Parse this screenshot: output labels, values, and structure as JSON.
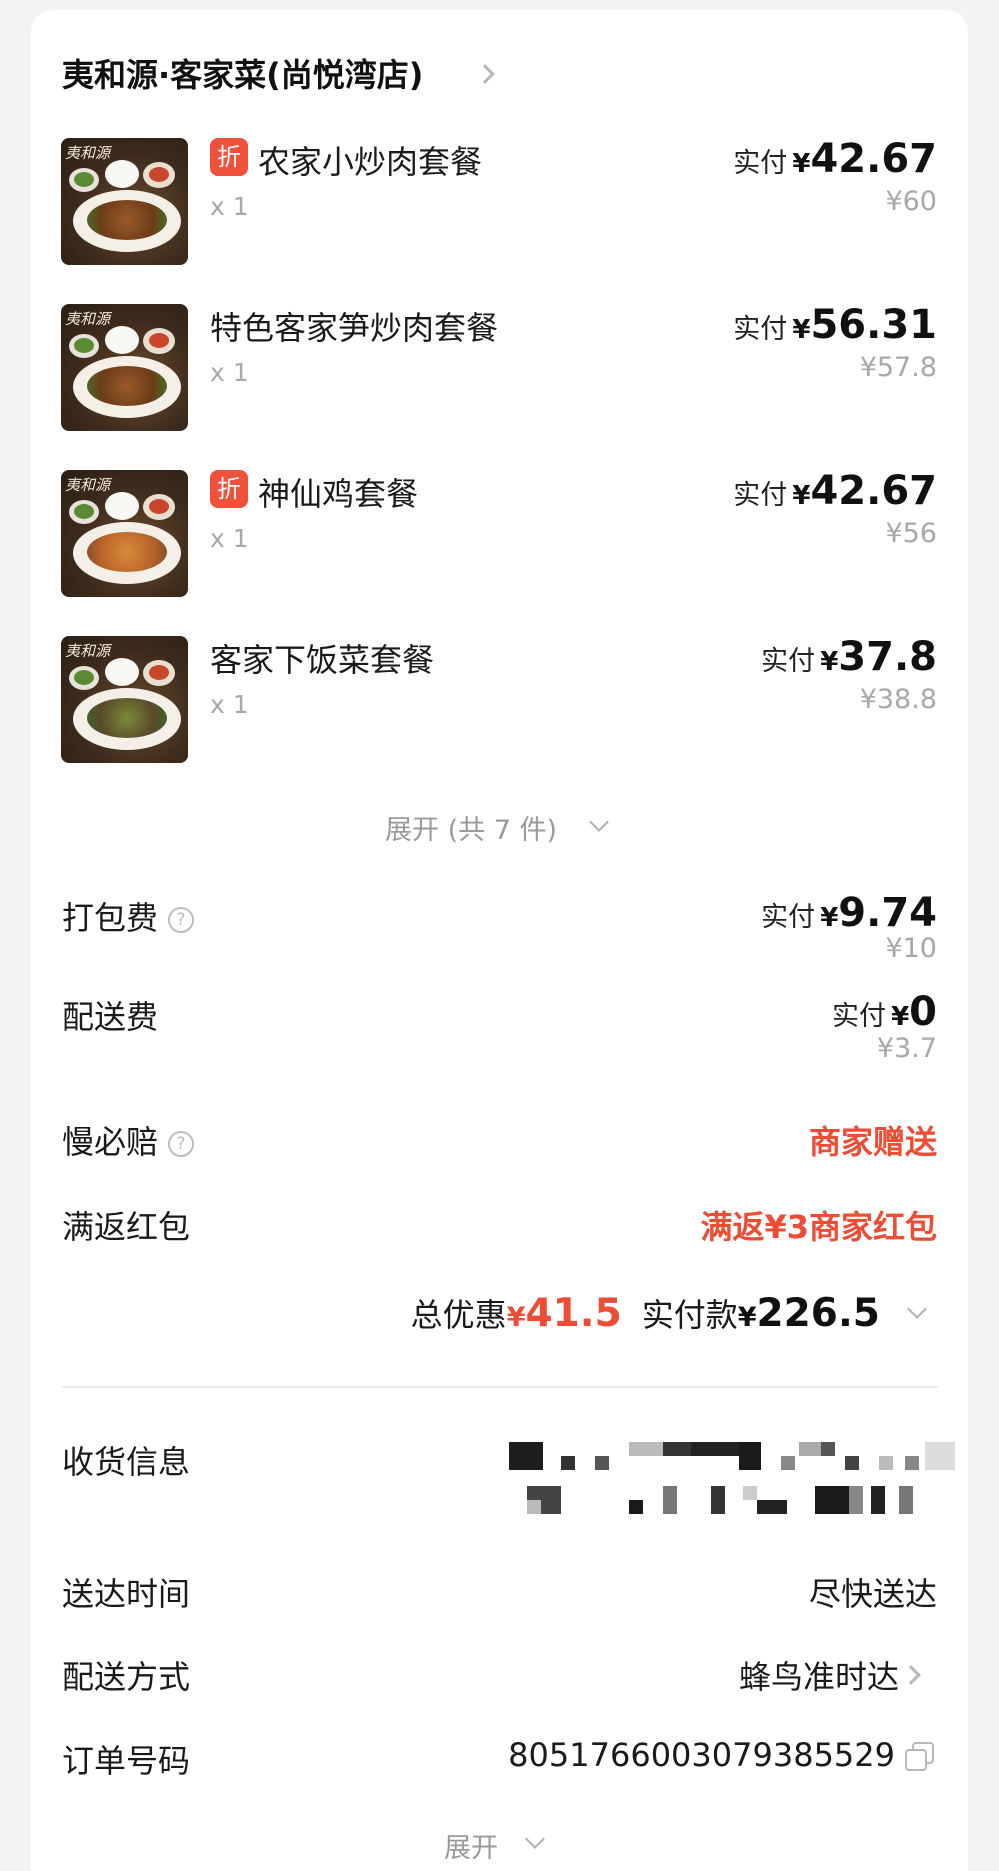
{
  "store": {
    "name": "夷和源·客家菜(尚悦湾店)"
  },
  "items": [
    {
      "name": "农家小炒肉套餐",
      "discount_tag": "折",
      "qty": "x 1",
      "paid_label": "实付",
      "currency": "¥",
      "paid": "42.67",
      "original": "¥60",
      "brand_text": "夷和源"
    },
    {
      "name": "特色客家笋炒肉套餐",
      "discount_tag": "",
      "qty": "x 1",
      "paid_label": "实付",
      "currency": "¥",
      "paid": "56.31",
      "original": "¥57.8",
      "brand_text": "夷和源"
    },
    {
      "name": "神仙鸡套餐",
      "discount_tag": "折",
      "qty": "x 1",
      "paid_label": "实付",
      "currency": "¥",
      "paid": "42.67",
      "original": "¥56",
      "brand_text": "夷和源"
    },
    {
      "name": "客家下饭菜套餐",
      "discount_tag": "",
      "qty": "x 1",
      "paid_label": "实付",
      "currency": "¥",
      "paid": "37.8",
      "original": "¥38.8",
      "brand_text": "夷和源"
    }
  ],
  "expand_items": {
    "label": "展开 (共 7 件)"
  },
  "fees": {
    "packing": {
      "label": "打包费",
      "help": "?",
      "paid_label": "实付",
      "currency": "¥",
      "paid": "9.74",
      "original": "¥10"
    },
    "delivery": {
      "label": "配送费",
      "paid_label": "实付",
      "currency": "¥",
      "paid": "0",
      "original": "¥3.7"
    }
  },
  "slow_compensation": {
    "label": "慢必赔",
    "help": "?",
    "value": "商家赠送"
  },
  "red_packet": {
    "label": "满返红包",
    "value": "满返¥3商家红包"
  },
  "totals": {
    "discount_label": "总优惠",
    "currency": "¥",
    "discount": "41.5",
    "paid_label": "实付款",
    "paid": "226.5"
  },
  "info": {
    "receiver_label": "收货信息",
    "delivery_time_label": "送达时间",
    "delivery_time_value": "尽快送达",
    "delivery_method_label": "配送方式",
    "delivery_method_value": "蜂鸟准时达",
    "order_no_label": "订单号码",
    "order_no_value": "8051766003079385529"
  },
  "expand_more": {
    "label": "展开"
  },
  "colors": {
    "accent_red": "#eb4d35",
    "tag_red": "#f0513a",
    "muted": "#a8a8a8"
  }
}
